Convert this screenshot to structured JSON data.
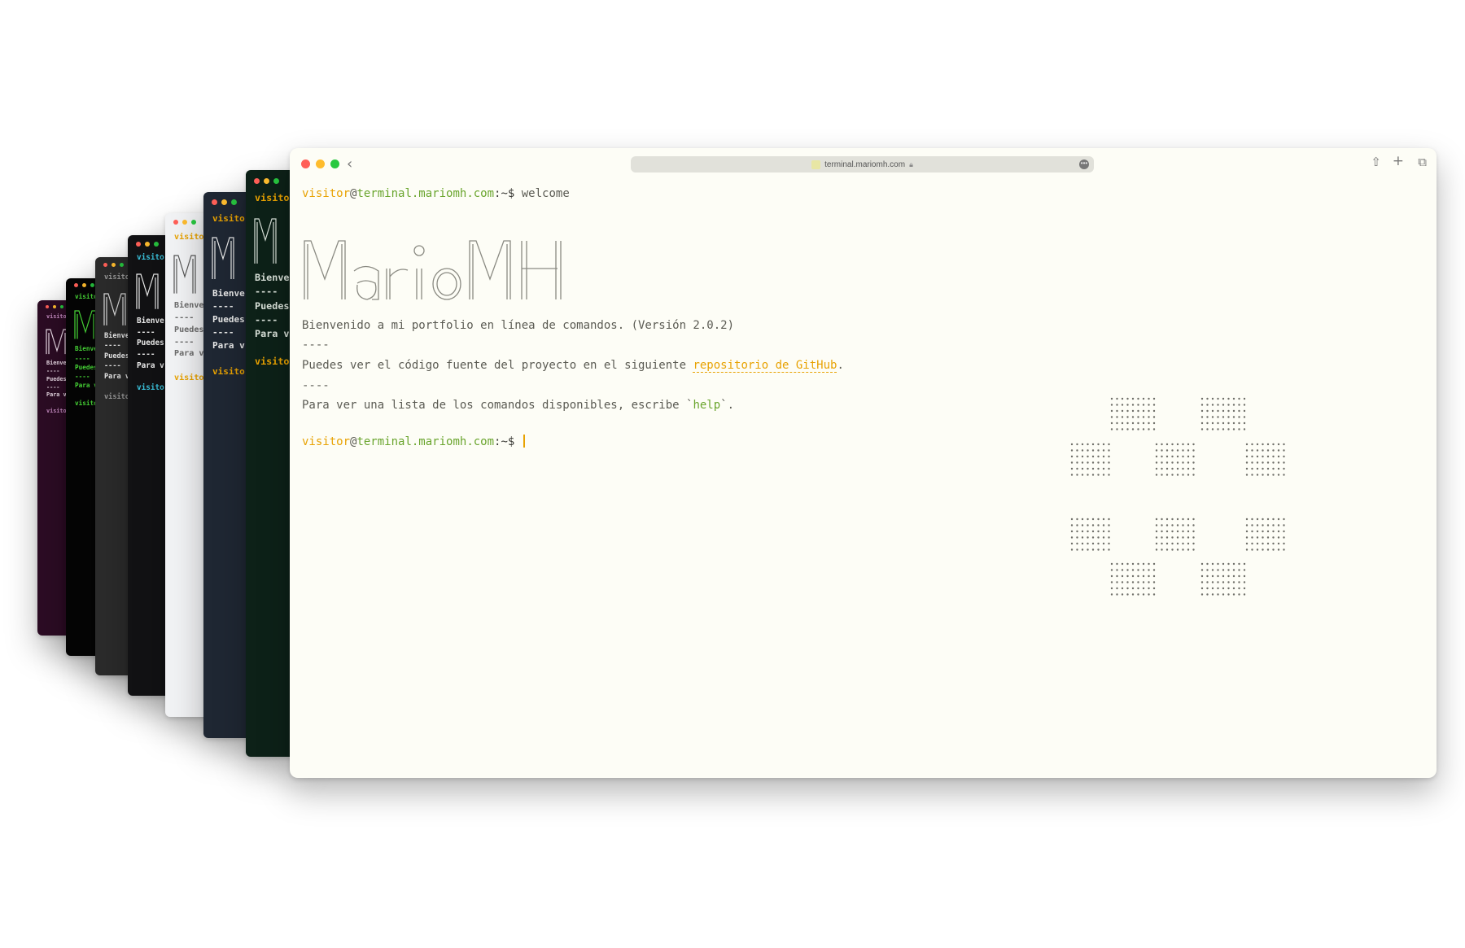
{
  "stack_windows": [
    {
      "id": "purple",
      "prompt": "visito",
      "lines": [
        "Bienve",
        "----",
        "Puedes",
        "----",
        "Para v"
      ],
      "bottom_prompt": "visito",
      "bg": "#2c0c24",
      "prompt_color": "#c48ac0",
      "text_color": "#e8d8e4",
      "logo_color": "#e8d8e4"
    },
    {
      "id": "black-green",
      "prompt": "visito",
      "lines": [
        "Bienve",
        "----",
        "Puedes",
        "----",
        "Para v"
      ],
      "bottom_prompt": "visito",
      "bg": "#050505",
      "prompt_color": "#4ade39",
      "text_color": "#4ade39",
      "logo_color": "#4ade39"
    },
    {
      "id": "gray",
      "prompt": "visito",
      "lines": [
        "Bienve",
        "----",
        "Puedes",
        "----",
        "Para v"
      ],
      "bottom_prompt": "visito",
      "bg": "#2b2b2b",
      "prompt_color": "#9a9a9a",
      "text_color": "#e8e8e8",
      "logo_color": "#d8d8d8"
    },
    {
      "id": "black-cyan",
      "prompt": "visito",
      "lines": [
        "Bienve",
        "----",
        "Puedes",
        "----",
        "Para v"
      ],
      "bottom_prompt": "visito",
      "bg": "#121214",
      "prompt_color": "#3cc6e0",
      "text_color": "#f0f0f0",
      "logo_color": "#f0f0f0"
    },
    {
      "id": "light",
      "prompt": "visito",
      "lines": [
        "Bienve",
        "----",
        "Puedes",
        "----",
        "Para v"
      ],
      "bottom_prompt": "visito",
      "bg": "#f1f2f4",
      "prompt_color": "#e8a202",
      "text_color": "#6b6b6b",
      "logo_color": "#555555"
    },
    {
      "id": "navy",
      "prompt": "visito",
      "lines": [
        "Bienve",
        "----",
        "Puedes",
        "----",
        "Para v"
      ],
      "bottom_prompt": "visito",
      "bg": "#1f2733",
      "prompt_color": "#e8a202",
      "text_color": "#e8e8e8",
      "logo_color": "#e8e8e8"
    },
    {
      "id": "dark-green",
      "prompt": "visito",
      "lines": [
        "Bienve",
        "----",
        "Puedes",
        "----",
        "Para v"
      ],
      "bottom_prompt": "visito",
      "bg": "#0d2118",
      "prompt_color": "#e8a202",
      "text_color": "#d8e0d8",
      "logo_color": "#d8e0d8"
    }
  ],
  "browser": {
    "url": "terminal.mariomh.com",
    "back_glyph": "‹",
    "share_glyph": "⇧",
    "newtab_glyph": "+",
    "tabs_glyph": "⧉",
    "more_glyph": "•••"
  },
  "terminal": {
    "prompt_user": "visitor",
    "prompt_at": "@",
    "prompt_host": "terminal.mariomh.com",
    "prompt_suffix": ":~$ ",
    "command": "welcome",
    "welcome": "Bienvenido a mi portfolio en línea de comandos. (Versión 2.0.2)",
    "sep1": "----",
    "source_before": "Puedes ver el código fuente del proyecto en el siguiente ",
    "source_link": "repositorio de GitHub",
    "source_after": ".",
    "sep2": "----",
    "help_before": "Para ver una lista de los comandos disponibles, escribe `",
    "help_cmd": "help",
    "help_after": "`."
  }
}
